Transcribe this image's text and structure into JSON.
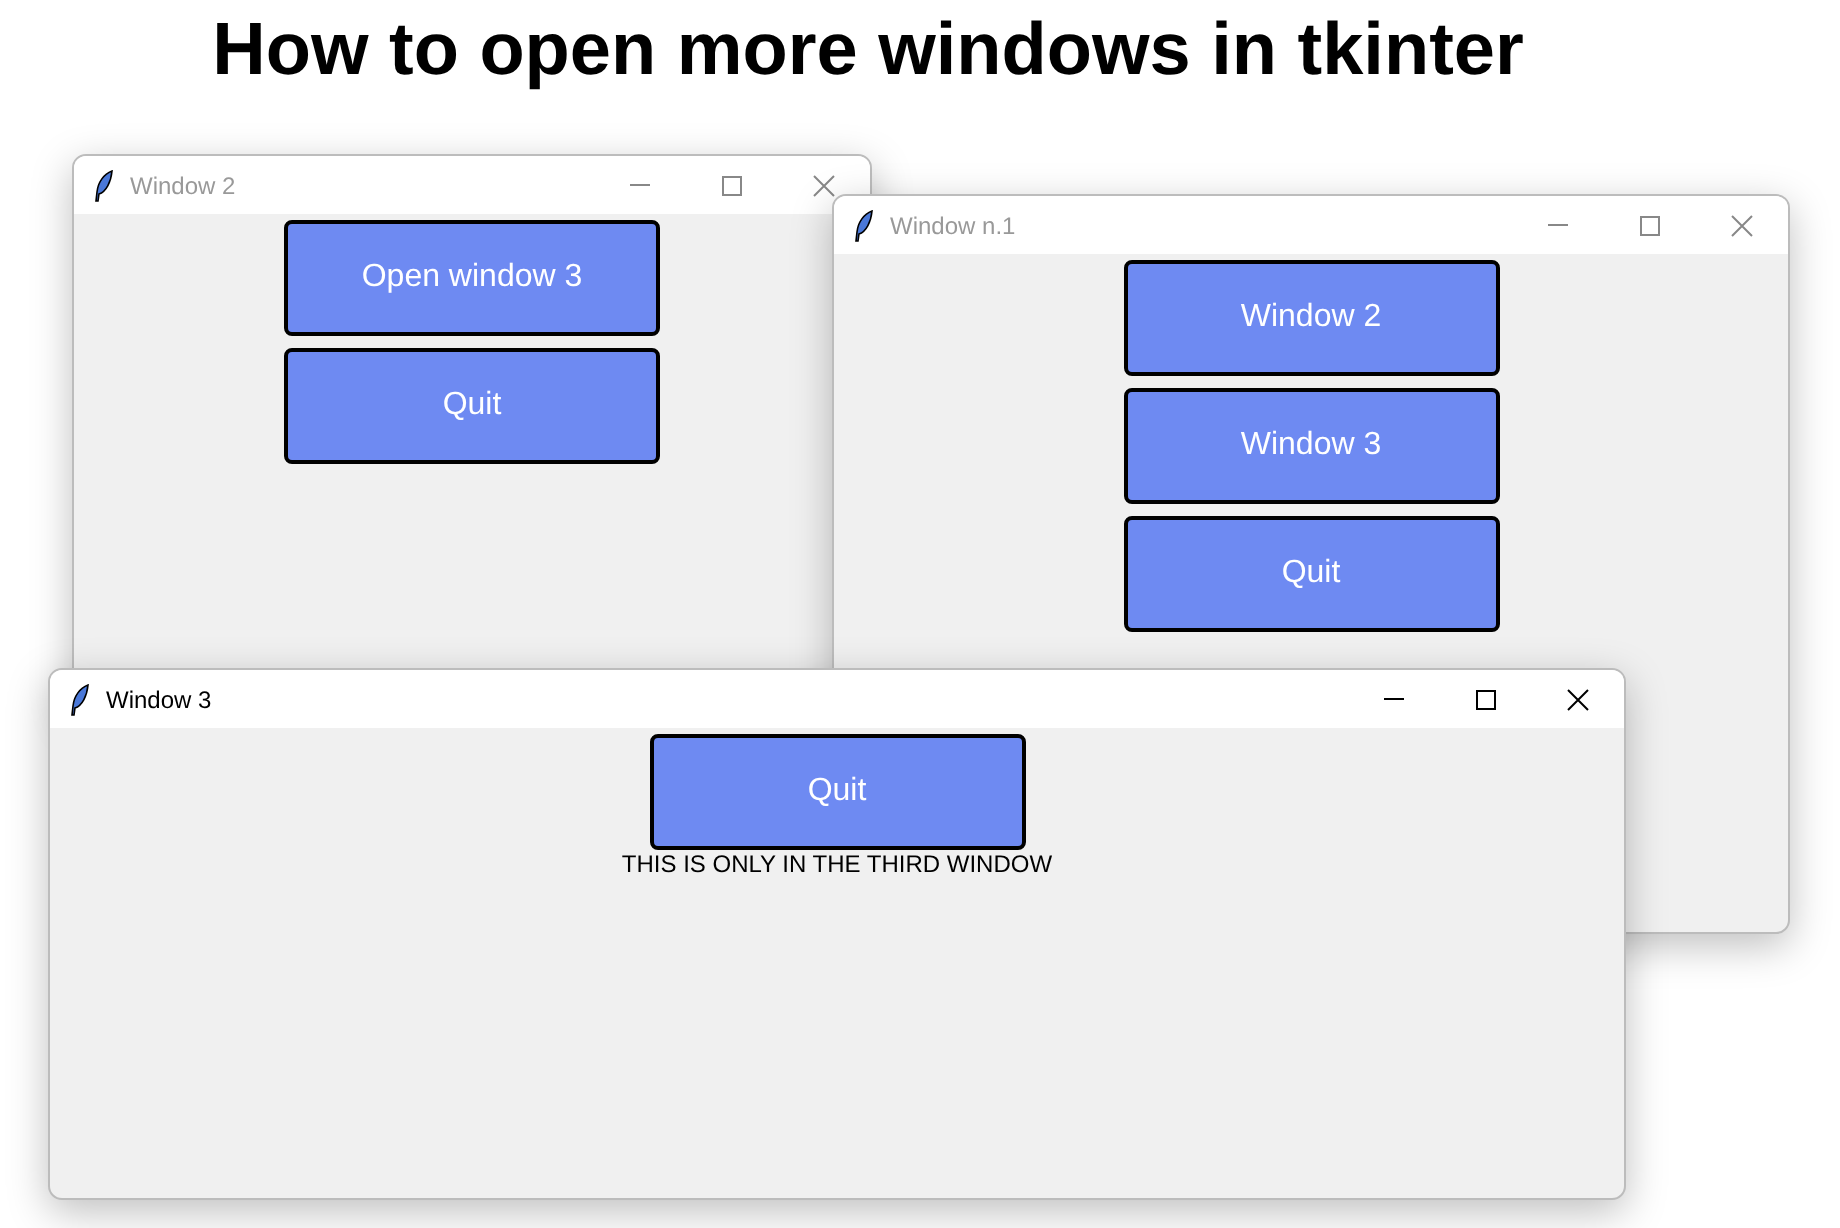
{
  "heading": "How to open more windows in tkinter",
  "windows": [
    {
      "title": "Window 2",
      "active": false,
      "buttons": [
        "Open window 3",
        "Quit"
      ]
    },
    {
      "title": "Window n.1",
      "active": false,
      "buttons": [
        "Window 2",
        "Window 3",
        "Quit"
      ]
    },
    {
      "title": "Window 3",
      "active": true,
      "buttons": [
        "Quit"
      ],
      "label": "THIS IS ONLY IN THE THIRD WINDOW"
    }
  ]
}
